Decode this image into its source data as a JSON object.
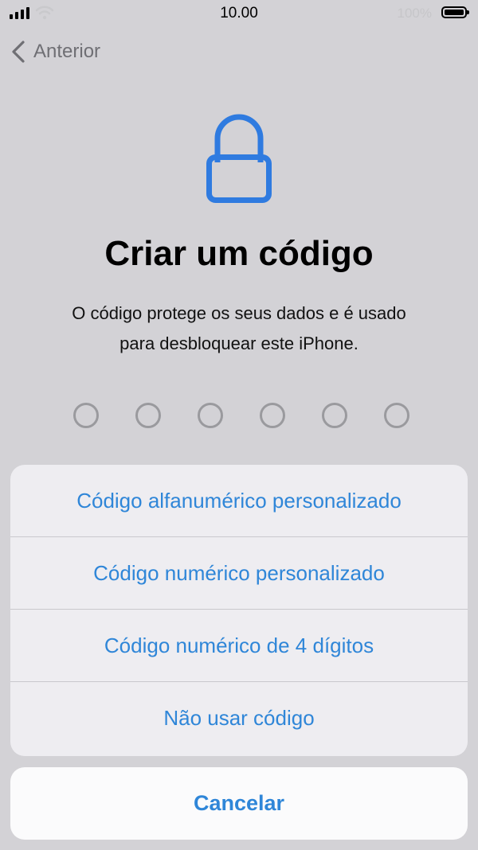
{
  "status_bar": {
    "time": "10.00",
    "battery_percent": "100%"
  },
  "nav": {
    "back_label": "Anterior"
  },
  "header": {
    "title": "Criar um código",
    "subtitle_line1": "O código protege os seus dados e é usado",
    "subtitle_line2": "para desbloquear este iPhone."
  },
  "passcode_dots": 6,
  "action_sheet": {
    "items": [
      {
        "label": "Código alfanumérico personalizado"
      },
      {
        "label": "Código numérico personalizado"
      },
      {
        "label": "Código numérico de 4 dígitos"
      },
      {
        "label": "Não usar código"
      }
    ],
    "cancel_label": "Cancelar"
  },
  "colors": {
    "accent": "#2f86d8",
    "lock_icon": "#2f7be0",
    "background": "#d3d2d6"
  }
}
